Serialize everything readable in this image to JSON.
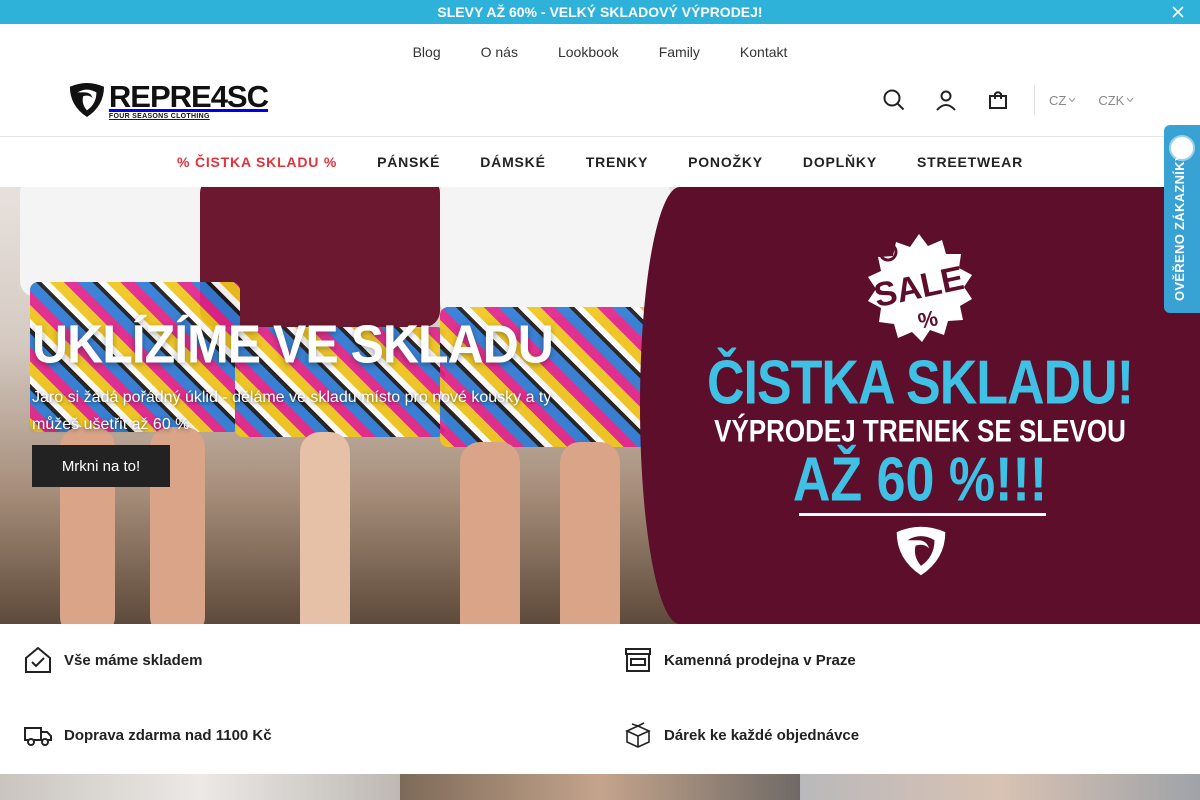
{
  "promo_bar": {
    "text": "SLEVY AŽ 60% - VELKÝ SKLADOVÝ VÝPRODEJ!",
    "bg_color": "#2fb2d9",
    "close_icon": "close-icon"
  },
  "top_links": [
    "Blog",
    "O nás",
    "Lookbook",
    "Family",
    "Kontakt"
  ],
  "logo": {
    "word": "REPRE4SC",
    "tagline": "FOUR SEASONS CLOTHING"
  },
  "header_icons": [
    "search-icon",
    "user-icon",
    "cart-icon"
  ],
  "language": "CZ",
  "currency": "CZK",
  "main_nav": [
    {
      "label": "% ČISTKA SKLADU %",
      "highlight": true
    },
    {
      "label": "PÁNSKÉ"
    },
    {
      "label": "DÁMSKÉ"
    },
    {
      "label": "TRENKY"
    },
    {
      "label": "PONOŽKY"
    },
    {
      "label": "DOPLŇKY"
    },
    {
      "label": "STREETWEAR"
    }
  ],
  "hero": {
    "title": "UKLÍZÍME VE SKLADU",
    "subtitle": "Jaro si žádá pořádný úklid - děláme ve skladu místo pro nové kousky a ty můžeš ušetřit až 60 %",
    "button_label": "Mrkni na to!",
    "badge_text": "SALE",
    "badge_sub": "%",
    "headline": "ČISTKA SKLADU!",
    "line2": "VÝPRODEJ TRENEK SE SLEVOU",
    "line3": "AŽ 60 %!!!",
    "panel_color": "#5c0e2b",
    "accent_color": "#3fc1e5"
  },
  "verified_tab": {
    "label": "OVĚŘENO ZÁKAZNÍKY"
  },
  "benefits": [
    {
      "icon": "home-check-icon",
      "label": "Vše máme skladem"
    },
    {
      "icon": "store-icon",
      "label": "Kamenná prodejna v Praze"
    },
    {
      "icon": "truck-icon",
      "label": "Doprava zdarma nad 1100 Kč"
    },
    {
      "icon": "gift-box-icon",
      "label": "Dárek ke každé objednávce"
    }
  ]
}
